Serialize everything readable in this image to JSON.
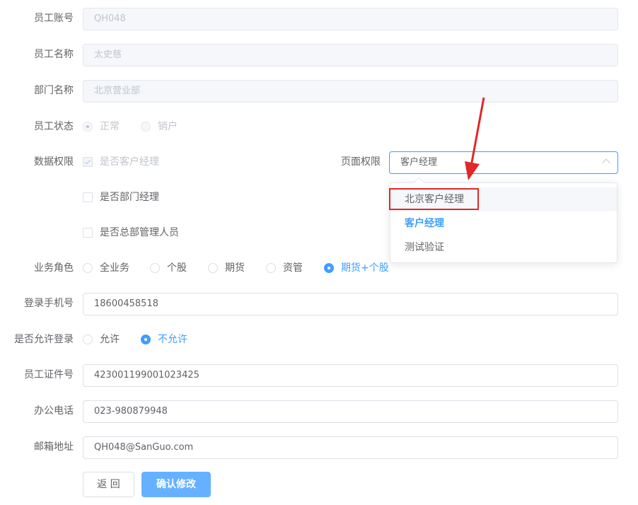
{
  "form": {
    "account": {
      "label": "员工账号",
      "value": "QH048"
    },
    "name": {
      "label": "员工名称",
      "value": "太史慈"
    },
    "department": {
      "label": "部门名称",
      "value": "北京营业部"
    },
    "status": {
      "label": "员工状态",
      "options": [
        "正常",
        "销户"
      ],
      "selected": "正常"
    },
    "data_permission": {
      "label": "数据权限",
      "checkboxes": [
        {
          "label": "是否客户经理",
          "checked": true,
          "disabled": true
        },
        {
          "label": "是否部门经理",
          "checked": false
        },
        {
          "label": "是否总部管理人员",
          "checked": false
        }
      ]
    },
    "page_permission": {
      "label": "页面权限",
      "value": "客户经理"
    },
    "business_role": {
      "label": "业务角色",
      "options": [
        "全业务",
        "个股",
        "期货",
        "资管",
        "期货+个股"
      ],
      "selected": "期货+个股"
    },
    "phone": {
      "label": "登录手机号",
      "value": "18600458518"
    },
    "allow_login": {
      "label": "是否允许登录",
      "options": [
        "允许",
        "不允许"
      ],
      "selected": "不允许"
    },
    "id_number": {
      "label": "员工证件号",
      "value": "423001199001023425"
    },
    "office_phone": {
      "label": "办公电话",
      "value": "023-980879948"
    },
    "email": {
      "label": "邮箱地址",
      "value": "QH048@SanGuo.com"
    }
  },
  "dropdown": {
    "options": [
      "北京客户经理",
      "客户经理",
      "测试验证"
    ],
    "hovered": "北京客户经理",
    "selected": "客户经理"
  },
  "buttons": {
    "back": "返 回",
    "confirm": "确认修改"
  },
  "colors": {
    "primary": "#409eff",
    "annotation": "#e02828"
  }
}
